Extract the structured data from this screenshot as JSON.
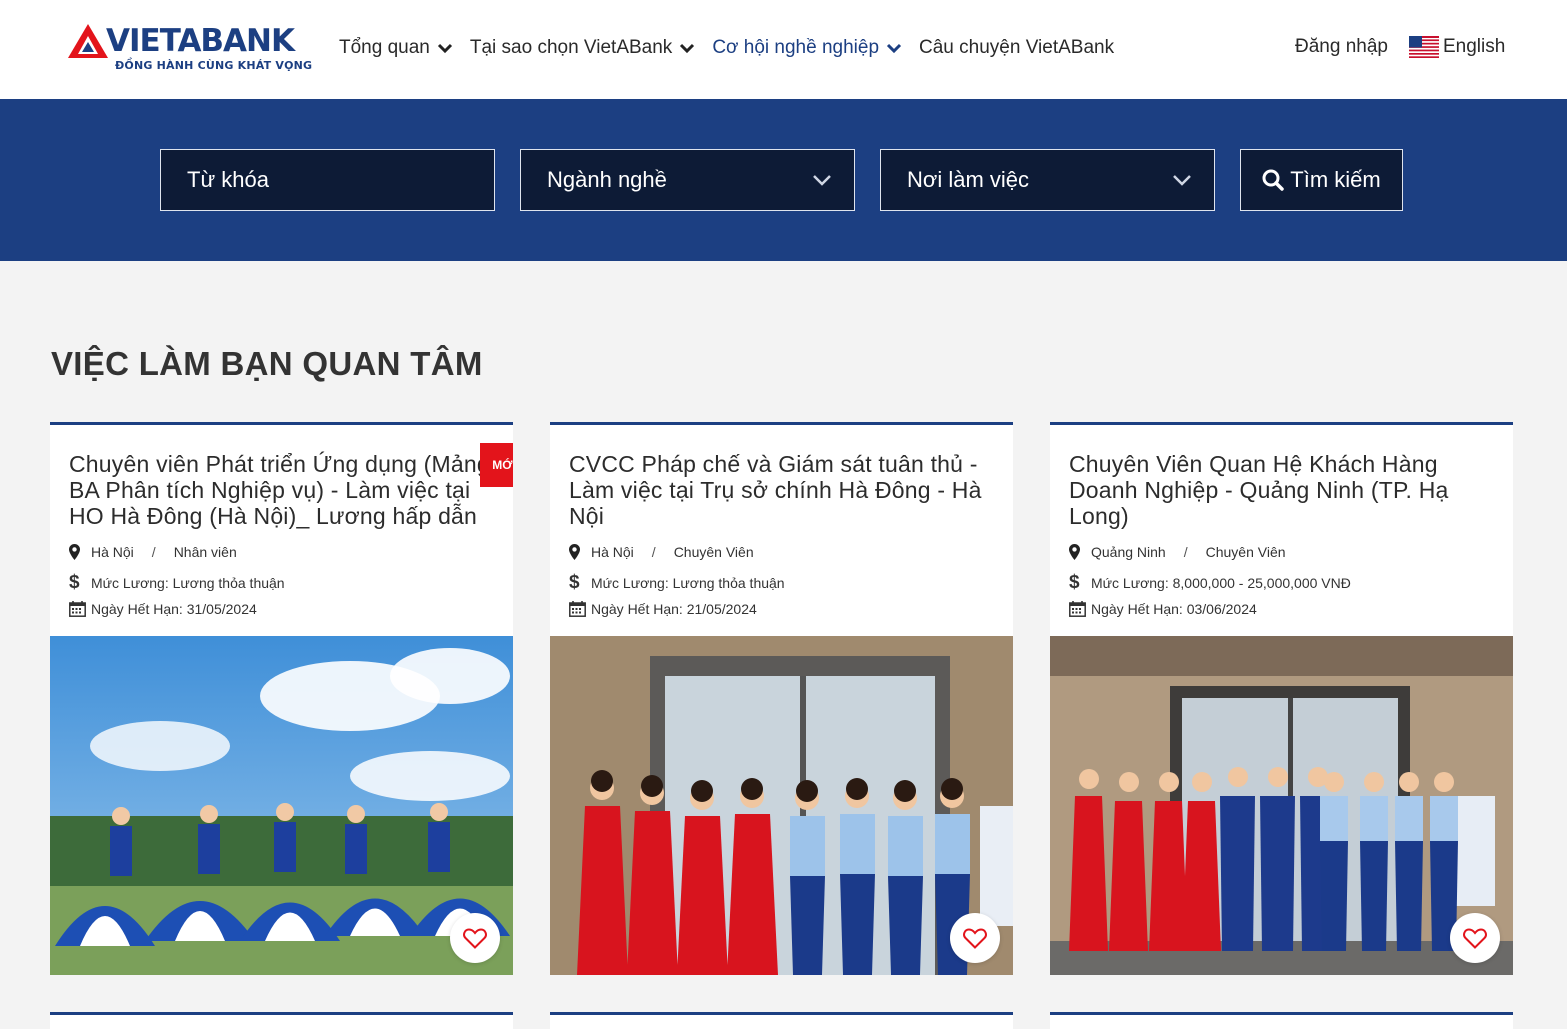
{
  "header": {
    "logo": {
      "brand": "VIETABANK",
      "tagline": "ĐỒNG HÀNH CÙNG KHÁT VỌNG",
      "icon": "vietabank-logo-mark"
    },
    "nav": [
      {
        "label": "Tổng quan",
        "has_dropdown": true
      },
      {
        "label": "Tại sao chọn VietABank",
        "has_dropdown": true
      },
      {
        "label": "Cơ hội nghề nghiệp",
        "has_dropdown": true,
        "active": true
      },
      {
        "label": "Câu chuyện VietABank",
        "has_dropdown": false
      }
    ],
    "login": "Đăng nhập",
    "language": {
      "label": "English",
      "icon": "us-flag-icon"
    }
  },
  "search": {
    "keyword_placeholder": "Từ khóa",
    "industry": "Ngành nghề",
    "location": "Nơi làm việc",
    "button": "Tìm kiếm"
  },
  "section_title": "VIỆC LÀM BẠN QUAN TÂM",
  "jobs": [
    {
      "title": "Chuyên viên Phát triển Ứng dụng (Mảng BA Phân tích Nghiệp vụ) - Làm việc tại HO Hà Đông (Hà Nội)_ Lương hấp dẫn",
      "badge": "MỚI",
      "location": "Hà Nội",
      "level": "Nhân viên",
      "salary": "Mức Lương: Lương thỏa thuận",
      "deadline": "Ngày Hết Hạn: 31/05/2024"
    },
    {
      "title": "CVCC Pháp chế và Giám sát tuân thủ - Làm việc tại Trụ sở chính Hà Đông - Hà Nội",
      "location": "Hà Nội",
      "level": "Chuyên Viên",
      "salary": "Mức Lương: Lương thỏa thuận",
      "deadline": "Ngày Hết Hạn: 21/05/2024"
    },
    {
      "title": "Chuyên Viên Quan Hệ Khách Hàng Doanh Nghiệp - Quảng Ninh (TP. Hạ Long)",
      "location": "Quảng Ninh",
      "level": "Chuyên Viên",
      "salary": "Mức Lương: 8,000,000 - 25,000,000 VNĐ",
      "deadline": "Ngày Hết Hạn: 03/06/2024"
    }
  ],
  "colors": {
    "brand_blue": "#1c3f82",
    "dark_field": "#0d1b36",
    "accent_red": "#e3141b",
    "page_bg": "#f3f3f3"
  }
}
